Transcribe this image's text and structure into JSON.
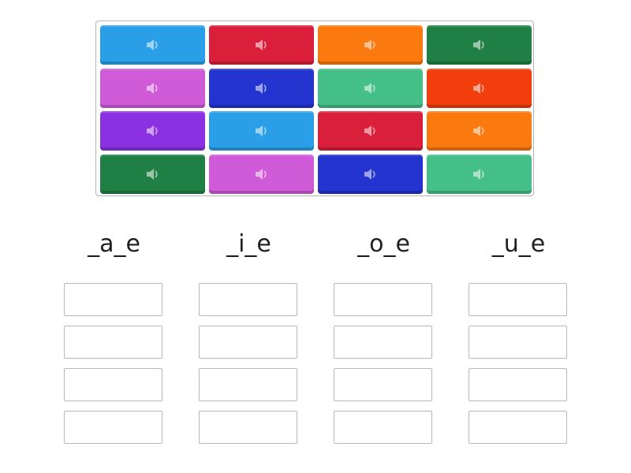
{
  "activity": {
    "type": "group-sort",
    "board": {
      "tiles": [
        {
          "color": "#2a9fe8",
          "icon": "speaker-icon"
        },
        {
          "color": "#d91f3a",
          "icon": "speaker-icon"
        },
        {
          "color": "#fb7a10",
          "icon": "speaker-icon"
        },
        {
          "color": "#1f7f45",
          "icon": "speaker-icon"
        },
        {
          "color": "#cf5bd8",
          "icon": "speaker-icon"
        },
        {
          "color": "#2334cf",
          "icon": "speaker-icon"
        },
        {
          "color": "#45bf88",
          "icon": "speaker-icon"
        },
        {
          "color": "#f23d0c",
          "icon": "speaker-icon"
        },
        {
          "color": "#8a32e2",
          "icon": "speaker-icon"
        },
        {
          "color": "#2a9fe8",
          "icon": "speaker-icon"
        },
        {
          "color": "#d91f3a",
          "icon": "speaker-icon"
        },
        {
          "color": "#fb7a10",
          "icon": "speaker-icon"
        },
        {
          "color": "#1f7f45",
          "icon": "speaker-icon"
        },
        {
          "color": "#cf5bd8",
          "icon": "speaker-icon"
        },
        {
          "color": "#2334cf",
          "icon": "speaker-icon"
        },
        {
          "color": "#45bf88",
          "icon": "speaker-icon"
        }
      ]
    },
    "groups": [
      {
        "heading": "_a_e",
        "slots": 4
      },
      {
        "heading": "_i_e",
        "slots": 4
      },
      {
        "heading": "_o_e",
        "slots": 4
      },
      {
        "heading": "_u_e",
        "slots": 4
      }
    ]
  }
}
